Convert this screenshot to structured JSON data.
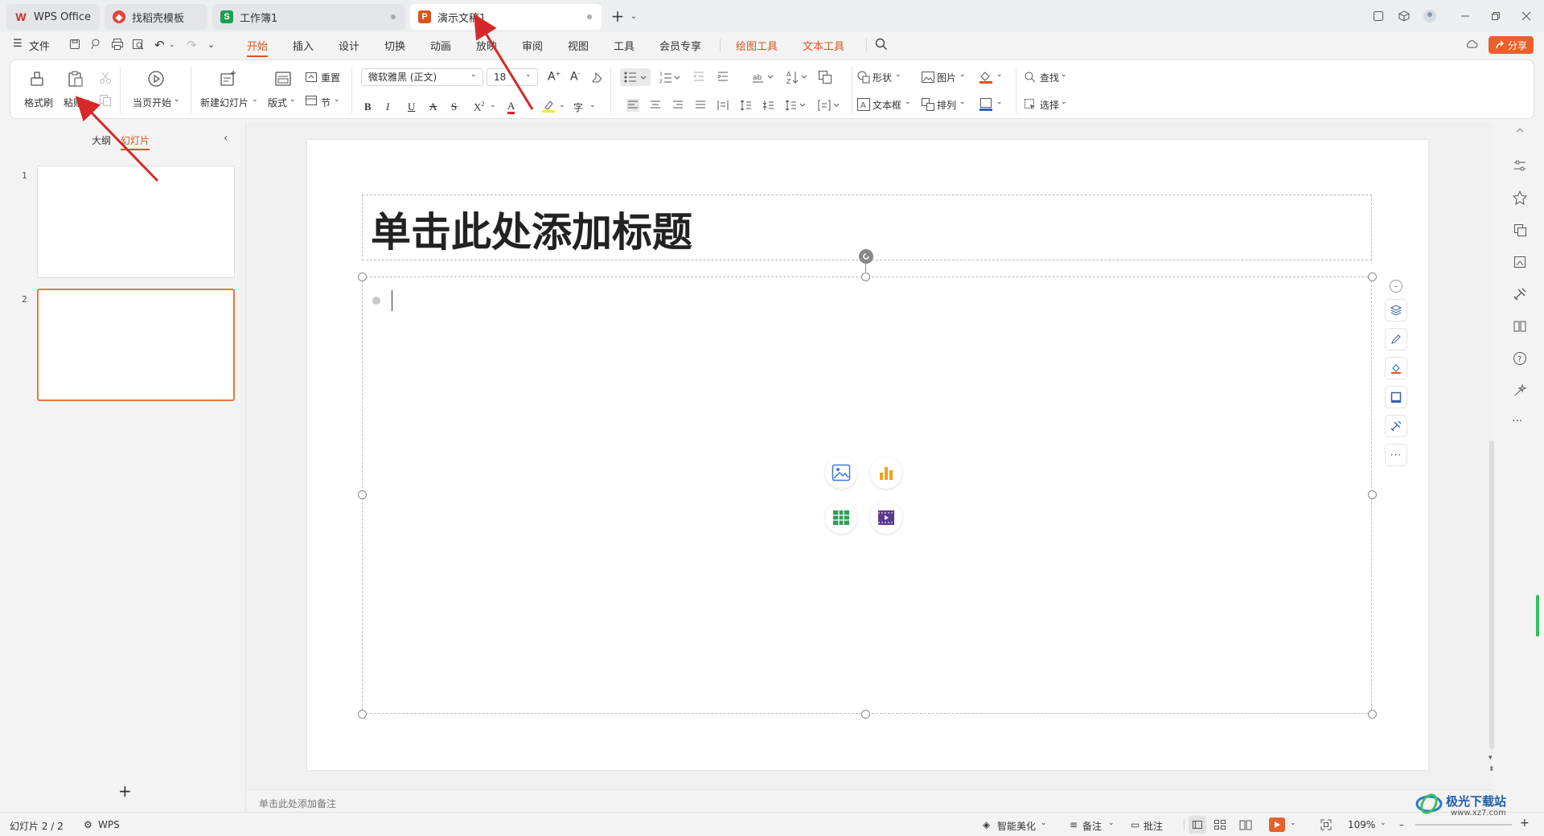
{
  "tabs": [
    {
      "label": "WPS Office",
      "icon": "wps-logo-icon"
    },
    {
      "label": "找稻壳模板",
      "icon": "docer-icon"
    },
    {
      "label": "工作簿1",
      "icon": "spreadsheet-icon",
      "badge": "S"
    },
    {
      "label": "演示文稿1",
      "icon": "presentation-icon",
      "badge": "P"
    }
  ],
  "menu": {
    "file": "文件",
    "items": [
      "开始",
      "插入",
      "设计",
      "切换",
      "动画",
      "放映",
      "审阅",
      "视图",
      "工具",
      "会员专享"
    ],
    "context_items": [
      "绘图工具",
      "文本工具"
    ],
    "active": "开始",
    "share": "分享"
  },
  "ribbon": {
    "format_painter": "格式刷",
    "paste": "粘贴",
    "play_from_current": "当页开始",
    "new_slide": "新建幻灯片",
    "layout": "版式",
    "reset": "重置",
    "section": "节",
    "font_name": "微软雅黑 (正文)",
    "font_size": "18",
    "shape": "形状",
    "picture": "图片",
    "textbox": "文本框",
    "arrange": "排列",
    "find": "查找",
    "select": "选择"
  },
  "panel": {
    "outline_tab": "大纲",
    "slides_tab": "幻灯片",
    "slide_numbers": [
      "1",
      "2"
    ],
    "add": "+"
  },
  "slide": {
    "title": "单击此处添加标题"
  },
  "notes": "单击此处添加备注",
  "status": {
    "slide_count": "幻灯片 2 / 2",
    "app": "WPS",
    "beautify": "智能美化",
    "notes": "备注",
    "comments": "批注",
    "zoom": "109%"
  },
  "watermark": {
    "site": "极光下载站",
    "url": "www.xz7.com"
  },
  "colors": {
    "accent": "#d9541c",
    "share_bg": "#e8612c",
    "selected_thumb": "#e8793c",
    "annotation_arrow": "#d62828"
  }
}
